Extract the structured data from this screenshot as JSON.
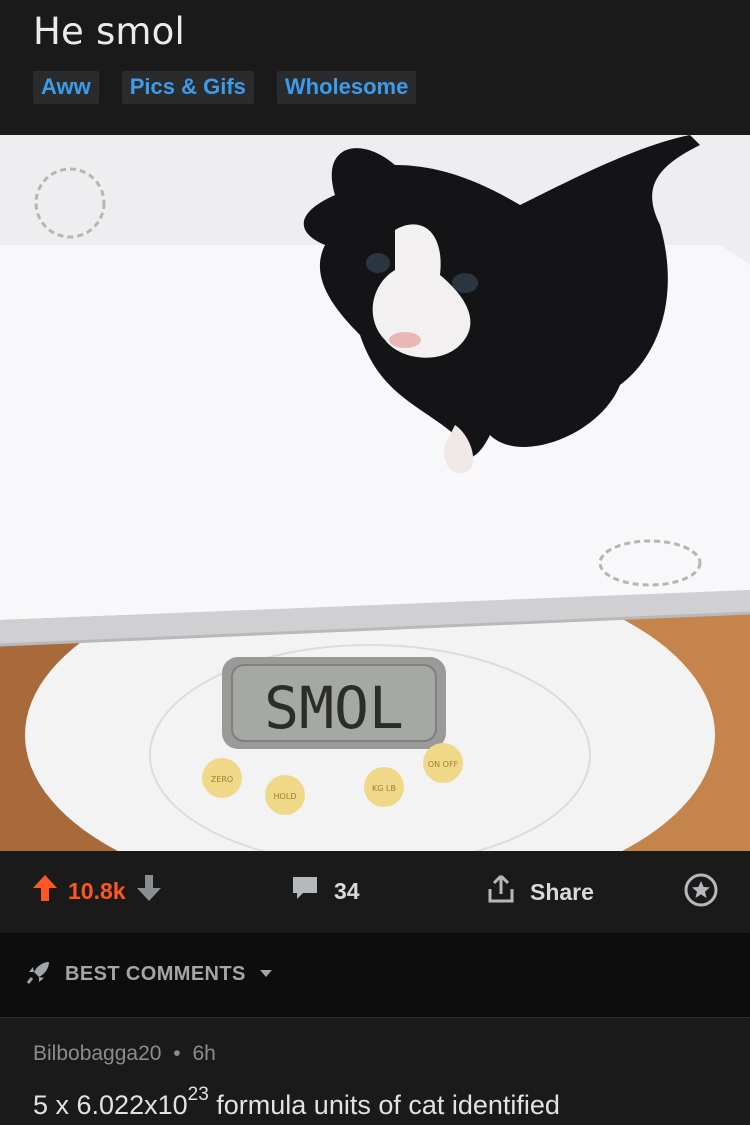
{
  "post": {
    "title": "He smol",
    "flairs": [
      "Aww",
      "Pics & Gifs",
      "Wholesome"
    ],
    "image": {
      "display_text": "SMOL",
      "button_labels": [
        "ZERO",
        "HOLD",
        "KG LB",
        "ON OFF"
      ]
    }
  },
  "actions": {
    "score": "10.8k",
    "comments": "34",
    "share_label": "Share"
  },
  "comments_section": {
    "sort_label": "BEST COMMENTS",
    "first_comment": {
      "author": "Bilbobagga20",
      "separator": "•",
      "age": "6h",
      "text_prefix": "5 x 6.022x10",
      "text_exponent": "23",
      "text_suffix": " formula units of cat identified"
    }
  },
  "colors": {
    "background": "#1a1a1b",
    "upvote": "#ff5722",
    "flair_text": "#3d9be9",
    "muted": "#8a8d91"
  }
}
